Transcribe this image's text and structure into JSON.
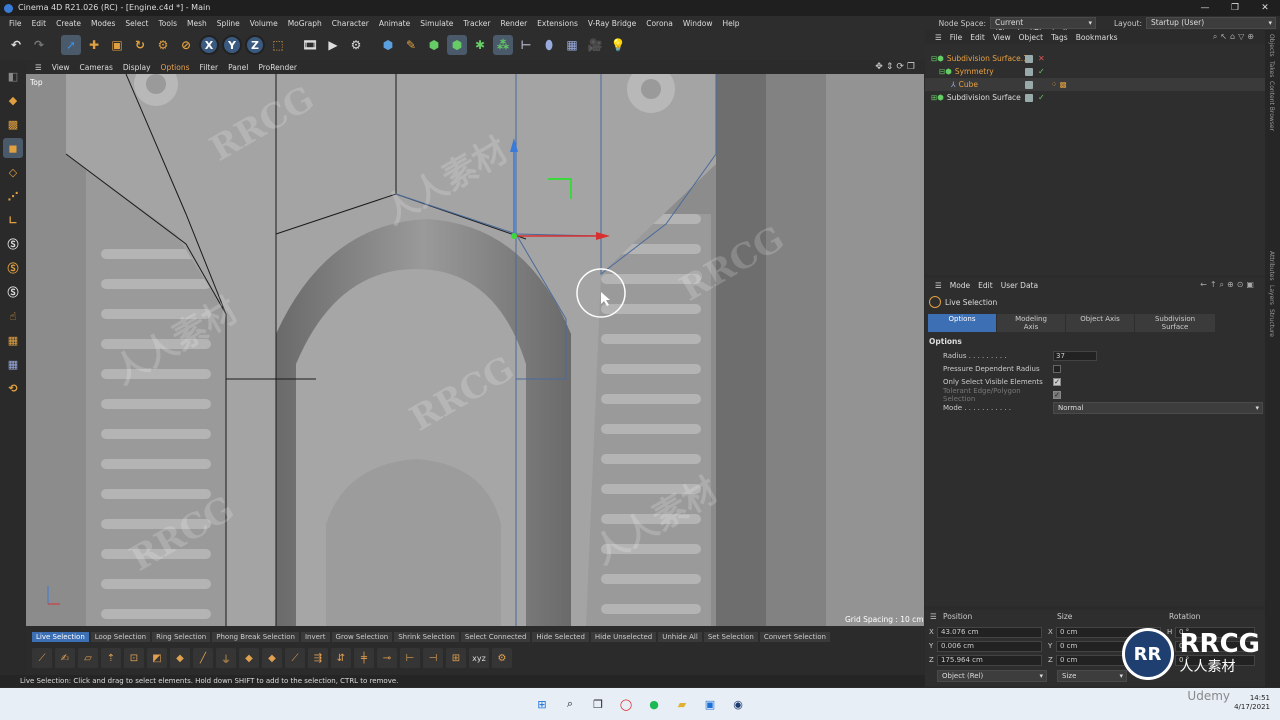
{
  "window": {
    "title": "Cinema 4D R21.026 (RC) - [Engine.c4d *] - Main",
    "controls": [
      "—",
      "❐",
      "✕"
    ]
  },
  "menubar": {
    "items": [
      "File",
      "Edit",
      "Create",
      "Modes",
      "Select",
      "Tools",
      "Mesh",
      "Spline",
      "Volume",
      "MoGraph",
      "Character",
      "Animate",
      "Simulate",
      "Tracker",
      "Render",
      "Extensions",
      "V-Ray Bridge",
      "Corona",
      "Window",
      "Help"
    ],
    "node_space_label": "Node Space:",
    "node_space_value": "Current (Standard/Physical)",
    "layout_label": "Layout:",
    "layout_value": "Startup (User)"
  },
  "viewport": {
    "menu": [
      "View",
      "Cameras",
      "Display",
      "Options",
      "Filter",
      "Panel",
      "ProRender"
    ],
    "active_menu": "Options",
    "view_name": "Top",
    "grid_spacing": "Grid Spacing : 10 cm"
  },
  "selection_bar": [
    "Live Selection",
    "Loop Selection",
    "Ring Selection",
    "Phong Break Selection",
    "Invert",
    "Grow Selection",
    "Shrink Selection",
    "Select Connected",
    "Hide Selected",
    "Hide Unselected",
    "Unhide All",
    "Set Selection",
    "Convert Selection"
  ],
  "status": "Live Selection: Click and drag to select elements. Hold down SHIFT to add to the selection, CTRL to remove.",
  "object_manager": {
    "menu": [
      "File",
      "Edit",
      "View",
      "Object",
      "Tags",
      "Bookmarks"
    ],
    "objects": [
      {
        "name": "Subdivision Surface.1",
        "color": "orange"
      },
      {
        "name": "Symmetry",
        "color": "orange"
      },
      {
        "name": "Cube",
        "color": "orange"
      },
      {
        "name": "Subdivision Surface",
        "color": "white"
      }
    ]
  },
  "attribute_manager": {
    "menu": [
      "Mode",
      "Edit",
      "User Data"
    ],
    "tool_name": "Live Selection",
    "tabs": [
      "Options",
      "Modeling Axis",
      "Object Axis",
      "Subdivision Surface"
    ],
    "section": "Options",
    "fields": {
      "radius_label": "Radius . . . . . . . . .",
      "radius_value": "37",
      "pressure_label": "Pressure Dependent Radius",
      "only_visible_label": "Only Select Visible Elements",
      "tolerant_label": "Tolerant Edge/Polygon Selection",
      "mode_label": "Mode . . . . . . . . . . .",
      "mode_value": "Normal"
    }
  },
  "coordinates": {
    "headers": [
      "Position",
      "Size",
      "Rotation"
    ],
    "rows": [
      {
        "axis": "X",
        "pos": "43.076 cm",
        "size": "0 cm",
        "rot_axis": "H",
        "rot": "0 °"
      },
      {
        "axis": "Y",
        "pos": "0.006 cm",
        "size": "0 cm",
        "rot_axis": "P",
        "rot": "0 °"
      },
      {
        "axis": "Z",
        "pos": "175.964 cm",
        "size": "0 cm",
        "rot_axis": "B",
        "rot": "0 °"
      }
    ],
    "mode": "Object (Rel)",
    "apply": "Size"
  },
  "right_strip": [
    "Objects",
    "Takes",
    "Content Browser",
    "Attributes",
    "Layers",
    "Structure"
  ],
  "watermarks": {
    "rrcg": "RRCG",
    "cn": "人人素材",
    "logo_cn": "人人素材",
    "udemy": "Udemy"
  },
  "tray": {
    "time": "14:51",
    "date": "4/17/2021"
  }
}
